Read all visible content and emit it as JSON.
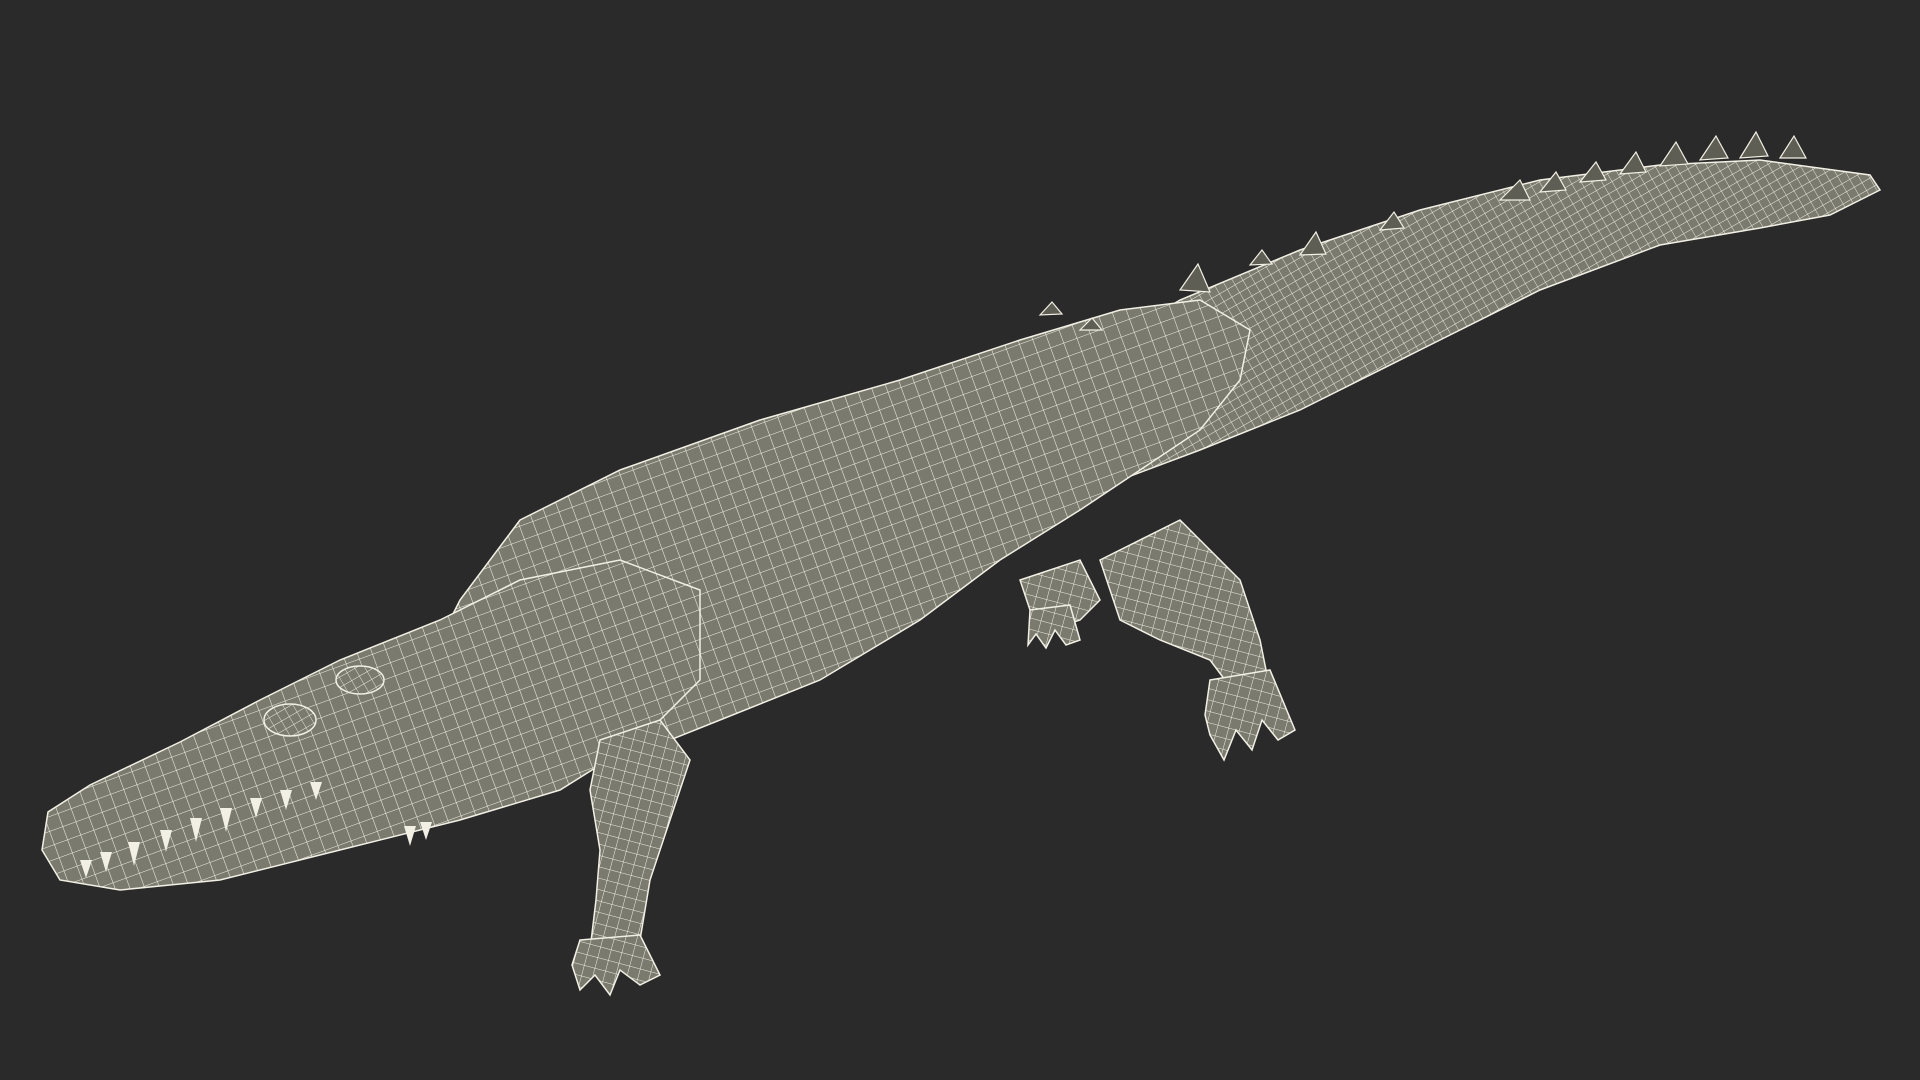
{
  "scene": {
    "subject": "crocodile-wireframe-model",
    "background_color": "#2a2a2a",
    "mesh_fill_color": "#7a7a6e",
    "wire_color": "#f2f0e4",
    "shadow_fill_color": "#5e5e54"
  }
}
